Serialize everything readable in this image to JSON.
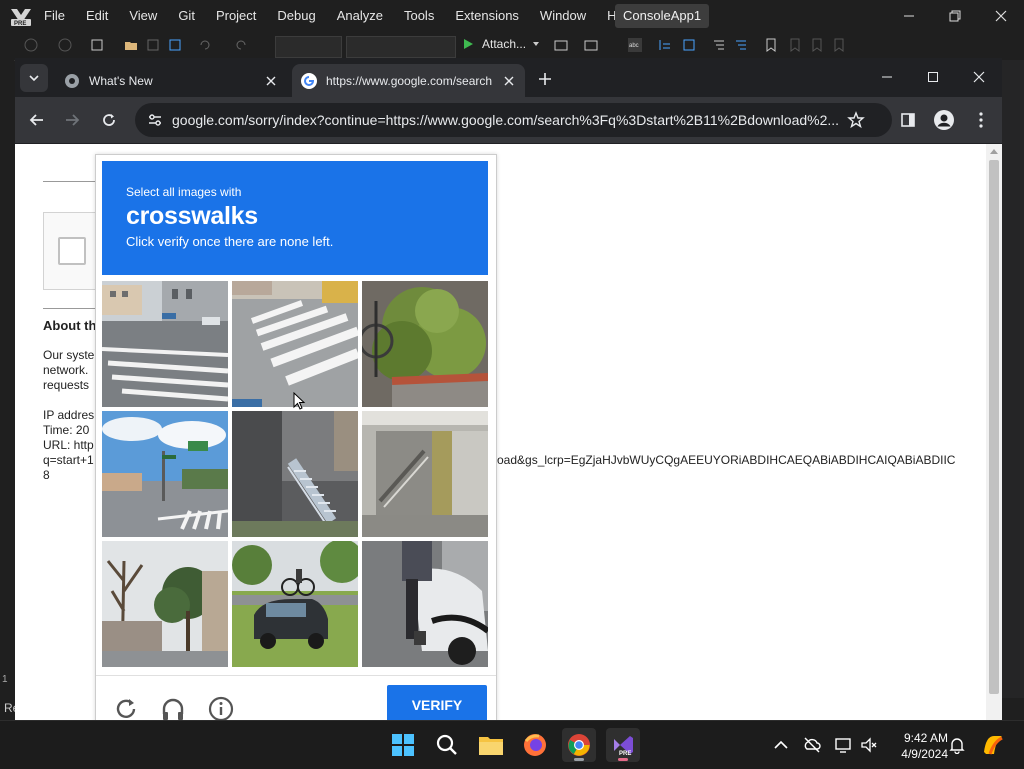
{
  "vs": {
    "menu": [
      "File",
      "Edit",
      "View",
      "Git",
      "Project",
      "Debug",
      "Analyze",
      "Tools",
      "Extensions",
      "Window",
      "Help"
    ],
    "project_name": "ConsoleApp1",
    "attach_label": "Attach...",
    "status_left": "Re",
    "side_digit": "1"
  },
  "browser": {
    "tabs": [
      {
        "title": "What's New",
        "active": false
      },
      {
        "title": "https://www.google.com/search",
        "active": true
      }
    ],
    "url": "google.com/sorry/index?continue=https://www.google.com/search%3Fq%3Dstart%2B11%2Bdownload%2..."
  },
  "page": {
    "about_title": "About th",
    "body_lines": "Our syste\nnetwork.\nrequests\n\nIP addres\nTime: 20\nURL: http\nq=start+1\n8",
    "url_tail": "oad&gs_lcrp=EgZjaHJvbWUyCQgAEEUYORiABDIHCAEQABiABDIHCAIQABiABDIIC"
  },
  "captcha": {
    "line1": "Select all images with",
    "keyword": "crosswalks",
    "line3": "Click verify once there are none left.",
    "verify_label": "VERIFY",
    "brand_color": "#1a73e8",
    "tiles": [
      "crosswalk-street-corner",
      "crosswalk-close-up",
      "bush-and-bicycle",
      "intersection-with-crosswalk",
      "exterior-stairs",
      "parking-garage-stairs",
      "trees-and-building",
      "car-and-cyclist",
      "person-on-scooter"
    ]
  },
  "taskbar": {
    "time": "9:42 AM",
    "date": "4/9/2024"
  }
}
